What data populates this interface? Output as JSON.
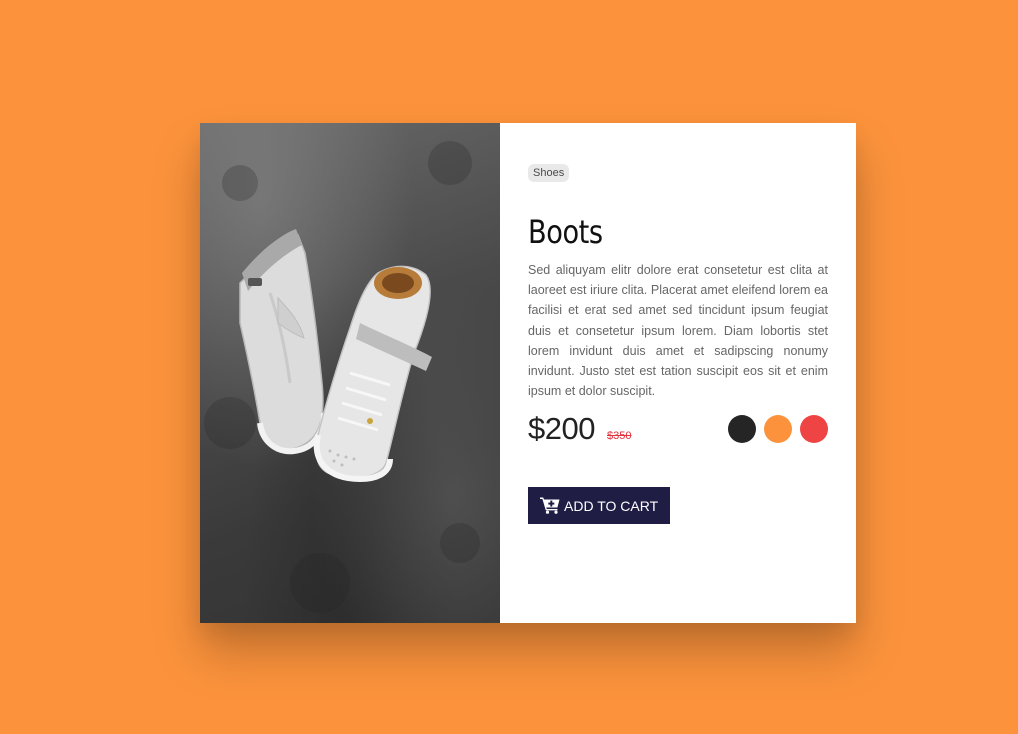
{
  "product": {
    "tag": "Shoes",
    "title": "Boots",
    "description": "Sed aliquyam elitr dolore erat consetetur est clita at laoreet est iriure clita. Placerat amet eleifend lorem ea facilisi et erat sed amet sed tincidunt ipsum feugiat duis et consetetur ipsum lorem. Diam lobortis stet lorem invidunt duis amet et sadipscing nonumy invidunt. Justo stet est tation suscipit eos sit et enim ipsum et dolor suscipit.",
    "price": "$200",
    "old_price": "$350",
    "colors": [
      "#252525",
      "#fc933c",
      "#ef4444"
    ],
    "add_to_cart_label": "ADD TO CART",
    "image_icon": "sneakers-photo",
    "cart_icon": "cart-plus-icon"
  },
  "theme": {
    "background": "#fc933c",
    "button": "#1f1d44",
    "sale_price": "#e0333c"
  }
}
